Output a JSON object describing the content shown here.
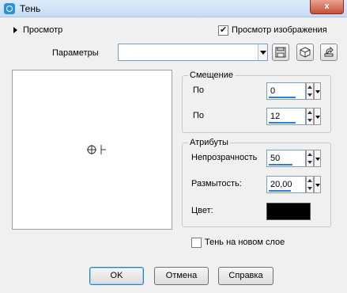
{
  "window": {
    "title": "Тень",
    "close_label": "x"
  },
  "preview_toggle": {
    "label": "Просмотр"
  },
  "preview_image_checkbox": {
    "label": "Просмотр изображения",
    "checked": true
  },
  "params": {
    "label": "Параметры",
    "value": ""
  },
  "offset_group": {
    "title": "Смещение",
    "fields": [
      {
        "label": "По",
        "value": "0"
      },
      {
        "label": "По",
        "value": "12"
      }
    ]
  },
  "attributes_group": {
    "title": "Атрибуты",
    "opacity": {
      "label": "Непрозрачность",
      "value": "50"
    },
    "blur": {
      "label": "Размытость:",
      "value": "20,00"
    },
    "color": {
      "label": "Цвет:",
      "value": "#000000"
    }
  },
  "new_layer_checkbox": {
    "label": "Тень на новом слое",
    "checked": false
  },
  "buttons": {
    "ok": "OK",
    "cancel": "Отмена",
    "help": "Справка"
  },
  "icons": [
    "app-icon",
    "expand-arrow-icon",
    "save-preset-icon",
    "reset-preset-icon",
    "preset-options-icon",
    "crosshair-icon"
  ]
}
